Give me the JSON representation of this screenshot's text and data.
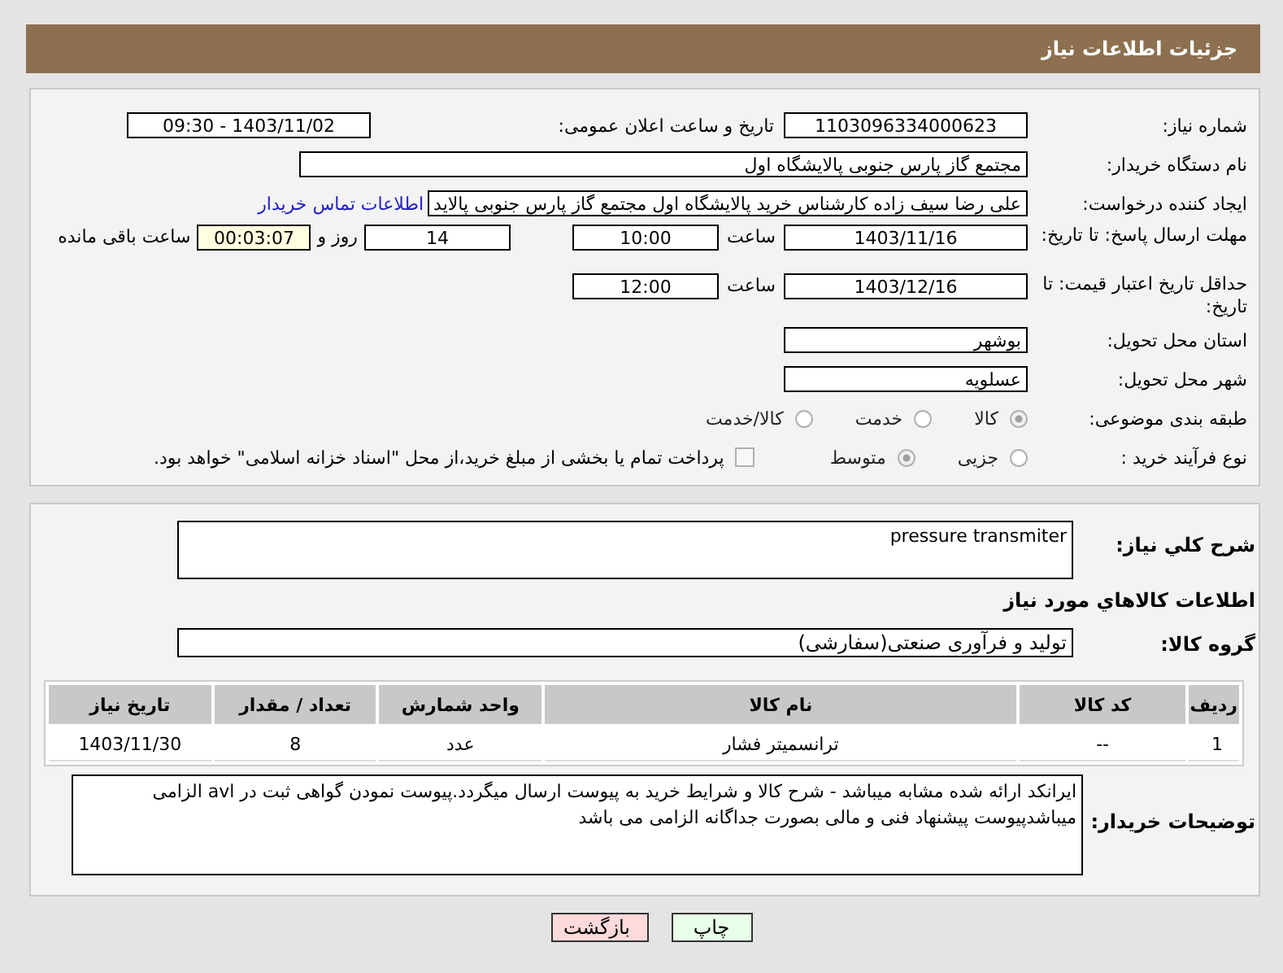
{
  "header": {
    "title": "جزئیات اطلاعات نیاز"
  },
  "need_number": {
    "label": "شماره نیاز:",
    "value": "1103096334000623"
  },
  "announce": {
    "label": "تاریخ و ساعت اعلان عمومی:",
    "value": "1403/11/02 - 09:30"
  },
  "buyer_org": {
    "label": "نام دستگاه خریدار:",
    "value": "مجتمع گاز پارس جنوبی  پالایشگاه اول"
  },
  "requester": {
    "label": "ایجاد کننده درخواست:",
    "value": "علی رضا سیف زاده کارشناس خرید پالایشگاه اول مجتمع گاز پارس جنوبی  پالاید",
    "link": "اطلاعات تماس خریدار"
  },
  "deadline": {
    "label": "مهلت ارسال پاسخ: تا تاریخ:",
    "date": "1403/11/16",
    "time_label": "ساعت",
    "time": "10:00",
    "days": "14",
    "days_label": "روز و",
    "remaining": "00:03:07",
    "remaining_label": "ساعت باقی مانده"
  },
  "price_validity": {
    "label": "حداقل تاریخ اعتبار قیمت: تا تاریخ:",
    "date": "1403/12/16",
    "time_label": "ساعت",
    "time": "12:00"
  },
  "province": {
    "label": "استان محل تحویل:",
    "value": "بوشهر"
  },
  "city": {
    "label": "شهر محل تحویل:",
    "value": "عسلویه"
  },
  "category": {
    "label": "طبقه بندی موضوعی:",
    "options": [
      {
        "label": "کالا",
        "selected": true
      },
      {
        "label": "خدمت",
        "selected": false
      },
      {
        "label": "کالا/خدمت",
        "selected": false
      }
    ]
  },
  "process": {
    "label": "نوع فرآیند خرید :",
    "options": [
      {
        "label": "جزیی",
        "selected": false
      },
      {
        "label": "متوسط",
        "selected": true
      }
    ],
    "payment": {
      "checked": false,
      "text": "پرداخت تمام یا بخشی از مبلغ خرید،از محل \"اسناد خزانه اسلامی\" خواهد بود."
    }
  },
  "description": {
    "label": "شرح کلي نیاز:",
    "value": "pressure transmiter"
  },
  "goods_heading": "اطلاعات کالاهاي مورد نیاز",
  "goods_group": {
    "label": "گروه کالا:",
    "value": "تولید و فرآوری صنعتی(سفارشی)"
  },
  "table": {
    "columns": [
      "ردیف",
      "کد کالا",
      "نام کالا",
      "واحد شمارش",
      "تعداد / مقدار",
      "تاریخ نیاز"
    ],
    "rows": [
      [
        "1",
        "--",
        "ترانسمیتر فشار",
        "عدد",
        "8",
        "1403/11/30"
      ]
    ]
  },
  "buyer_notes": {
    "label": "توضیحات خریدار:",
    "value": "ایرانکد ارائه شده مشابه میباشد -  شرح کالا و شرایط خرید به پیوست ارسال میگردد.پیوست نمودن گواهی ثبت در avl الزامی میباشدپیوست پیشنهاد فنی و مالی بصورت جداگانه الزامی می باشد"
  },
  "buttons": [
    {
      "kind": "print",
      "label": "چاپ"
    },
    {
      "kind": "back",
      "label": "بازگشت"
    }
  ]
}
